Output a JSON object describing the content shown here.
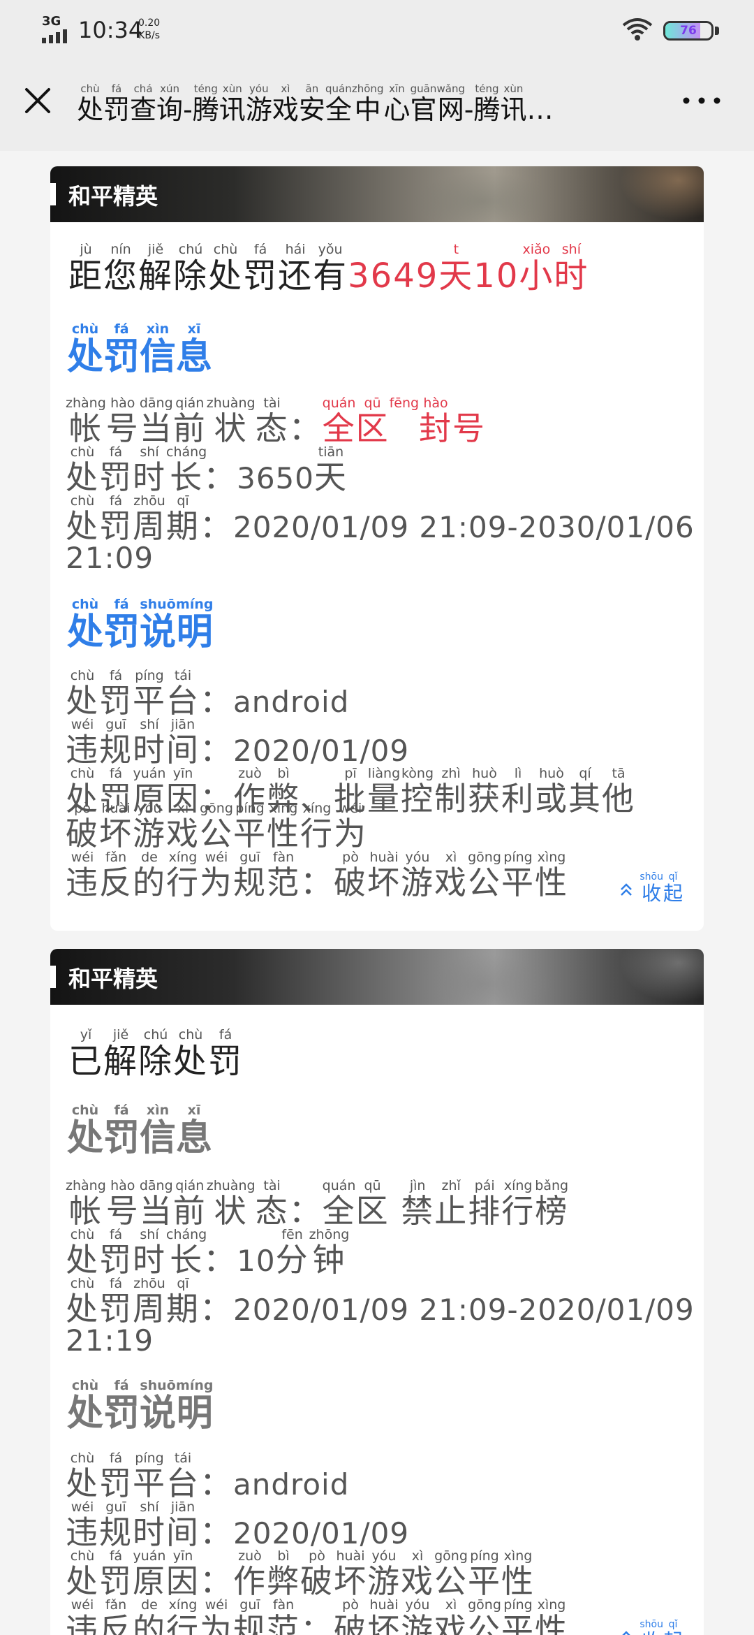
{
  "status": {
    "network": "3G",
    "time": "10:34",
    "speed_value": "0.20",
    "speed_unit": "KB/s",
    "battery": "76",
    "battery_level": 0.76
  },
  "nav": {
    "title": "处罚查询-腾讯游戏安全中心官网-腾讯…",
    "title_pinyin": [
      "chù",
      "fá",
      "chá",
      "xún",
      "téng",
      "xùn",
      "yóu",
      "xì",
      "ān",
      "quán",
      "zhōng",
      "xīn",
      "guān",
      "wǎng",
      "téng",
      "xùn"
    ]
  },
  "cards": [
    {
      "game": "和平精英",
      "status_line": {
        "text": "距您解除处罚还有",
        "pinyin": [
          "jù",
          "nín",
          "jiě",
          "chú",
          "chù",
          "fá",
          "hái",
          "yǒu"
        ],
        "remain_days": "3649",
        "day_char": "天",
        "day_pinyin": "tiān",
        "remain_hours": "10",
        "hour_chars": "小时",
        "hour_pinyin": [
          "xiǎo",
          "shí"
        ]
      },
      "info_heading": {
        "text": "处罚信息",
        "pinyin": [
          "chù",
          "fá",
          "xìn",
          "xī"
        ]
      },
      "account_state": {
        "label": "帐号当前状态：",
        "label_pinyin": [
          "zhàng",
          "hào",
          "dāng",
          "qián",
          "zhuàng",
          "tài"
        ],
        "value": "全区 封号",
        "value_pinyin": [
          "quán",
          "qū",
          "fēng",
          "hào"
        ]
      },
      "duration": {
        "label": "处罚时长：",
        "label_pinyin": [
          "chù",
          "fá",
          "shí",
          "cháng"
        ],
        "value": "3650",
        "unit": "天",
        "unit_pinyin": [
          "tiān"
        ]
      },
      "period": {
        "label": "处罚周期：",
        "label_pinyin": [
          "chù",
          "fá",
          "zhōu",
          "qī"
        ],
        "value": "2020/01/09 21:09-2030/01/06",
        "value_cont": "21:09"
      },
      "explain_heading": {
        "text": "处罚说明",
        "pinyin": [
          "chù",
          "fá",
          "shuō",
          "míng"
        ]
      },
      "platform": {
        "label": "处罚平台：",
        "label_pinyin": [
          "chù",
          "fá",
          "píng",
          "tái"
        ],
        "value": "android"
      },
      "violation_time": {
        "label": "违规时间：",
        "label_pinyin": [
          "wéi",
          "guī",
          "shí",
          "jiān"
        ],
        "value": "2020/01/09"
      },
      "reason": {
        "label": "处罚原因：",
        "label_pinyin": [
          "chù",
          "fá",
          "yuán",
          "yīn"
        ],
        "value": "作弊、批量控制获利或其他",
        "value_pinyin": [
          "zuò",
          "bì",
          "",
          "pī",
          "liàng",
          "kòng",
          "zhì",
          "huò",
          "lì",
          "huò",
          "qí",
          "tā"
        ],
        "value_cont": "破坏游戏公平性行为",
        "value_cont_pinyin": [
          "pò",
          "huài",
          "yóu",
          "xì",
          "gōng",
          "píng",
          "xìng",
          "xíng",
          "wéi"
        ]
      },
      "norm": {
        "label": "违反的行为规范：",
        "label_pinyin": [
          "wéi",
          "fǎn",
          "de",
          "xíng",
          "wéi",
          "guī",
          "fàn"
        ],
        "value": "破坏游戏公平性",
        "value_pinyin": [
          "pò",
          "huài",
          "yóu",
          "xì",
          "gōng",
          "píng",
          "xìng"
        ]
      },
      "collapse": {
        "text": "收起",
        "pinyin": [
          "shōu",
          "qǐ"
        ]
      }
    },
    {
      "game": "和平精英",
      "status_line": {
        "text": "已解除处罚",
        "pinyin": [
          "yǐ",
          "jiě",
          "chú",
          "chù",
          "fá"
        ]
      },
      "info_heading": {
        "text": "处罚信息",
        "pinyin": [
          "chù",
          "fá",
          "xìn",
          "xī"
        ]
      },
      "account_state": {
        "label": "帐号当前状态：",
        "label_pinyin": [
          "zhàng",
          "hào",
          "dāng",
          "qián",
          "zhuàng",
          "tài"
        ],
        "value": "全区 禁止排行榜",
        "value_pinyin": [
          "quán",
          "qū",
          "",
          "jìn",
          "zhǐ",
          "pái",
          "xíng",
          "bǎng"
        ]
      },
      "duration": {
        "label": "处罚时长：",
        "label_pinyin": [
          "chù",
          "fá",
          "shí",
          "cháng"
        ],
        "value": "10",
        "unit": "分钟",
        "unit_pinyin": [
          "fēn",
          "zhōng"
        ]
      },
      "period": {
        "label": "处罚周期：",
        "label_pinyin": [
          "chù",
          "fá",
          "zhōu",
          "qī"
        ],
        "value": "2020/01/09 21:09-2020/01/09",
        "value_cont": "21:19"
      },
      "explain_heading": {
        "text": "处罚说明",
        "pinyin": [
          "chù",
          "fá",
          "shuō",
          "míng"
        ]
      },
      "platform": {
        "label": "处罚平台：",
        "label_pinyin": [
          "chù",
          "fá",
          "píng",
          "tái"
        ],
        "value": "android"
      },
      "violation_time": {
        "label": "违规时间：",
        "label_pinyin": [
          "wéi",
          "guī",
          "shí",
          "jiān"
        ],
        "value": "2020/01/09"
      },
      "reason": {
        "label": "处罚原因：",
        "label_pinyin": [
          "chù",
          "fá",
          "yuán",
          "yīn"
        ],
        "value": "作弊破坏游戏公平性",
        "value_pinyin": [
          "zuò",
          "bì",
          "pò",
          "huài",
          "yóu",
          "xì",
          "gōng",
          "píng",
          "xìng"
        ]
      },
      "norm": {
        "label": "违反的行为规范：",
        "label_pinyin": [
          "wéi",
          "fǎn",
          "de",
          "xíng",
          "wéi",
          "guī",
          "fàn"
        ],
        "value": "破坏游戏公平性",
        "value_pinyin": [
          "pò",
          "huài",
          "yóu",
          "xì",
          "gōng",
          "píng",
          "xìng"
        ]
      },
      "collapse": {
        "text": "收起",
        "pinyin": [
          "shōu",
          "qǐ"
        ]
      }
    }
  ]
}
